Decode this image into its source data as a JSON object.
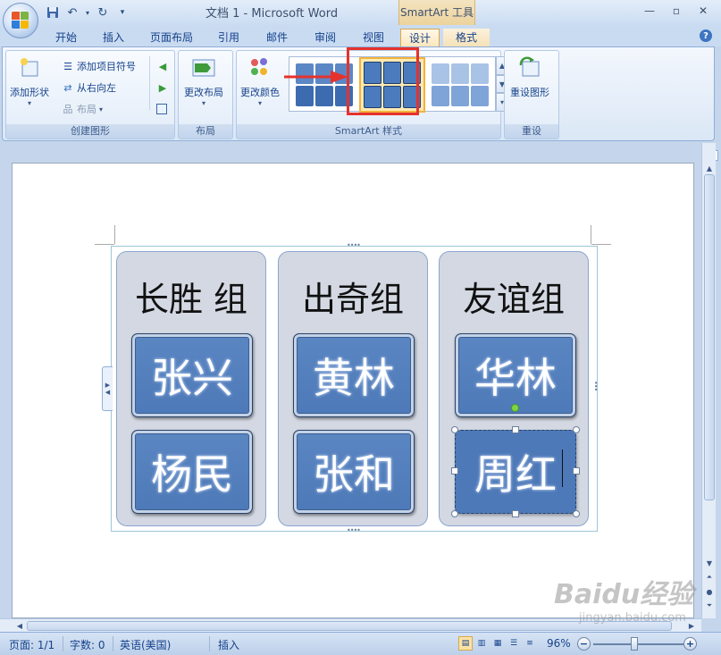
{
  "window": {
    "title": "文档 1 - Microsoft Word",
    "contextual_title": "SmartArt 工具"
  },
  "tabs": [
    "开始",
    "插入",
    "页面布局",
    "引用",
    "邮件",
    "审阅",
    "视图",
    "设计",
    "格式"
  ],
  "active_tab": "设计",
  "ribbon": {
    "create_group": {
      "label": "创建图形",
      "add_shape": "添加形状",
      "add_bullet": "添加项目符号",
      "right_to_left": "从右向左",
      "layout": "布局"
    },
    "layout_group": {
      "label": "布局",
      "change_layout": "更改布局"
    },
    "styles_group": {
      "label": "SmartArt 样式",
      "change_colors": "更改颜色"
    },
    "reset_group": {
      "label": "重设",
      "reset_graphic": "重设图形"
    }
  },
  "smartart": {
    "columns": [
      {
        "title": "长胜 组",
        "items": [
          "张兴",
          "杨民"
        ]
      },
      {
        "title": "出奇组",
        "items": [
          "黄林",
          "张和"
        ]
      },
      {
        "title": "友谊组",
        "items": [
          "华林",
          "周红"
        ]
      }
    ]
  },
  "status": {
    "page": "页面: 1/1",
    "words": "字数: 0",
    "language": "英语(美国)",
    "mode": "插入",
    "zoom": "96%"
  },
  "watermark": {
    "logo": "Baidu经验",
    "url": "jingyan.baidu.com"
  },
  "colors": {
    "accent": "#4e79b8",
    "highlight": "#e5322d",
    "ribbon": "#dbe7f6"
  }
}
